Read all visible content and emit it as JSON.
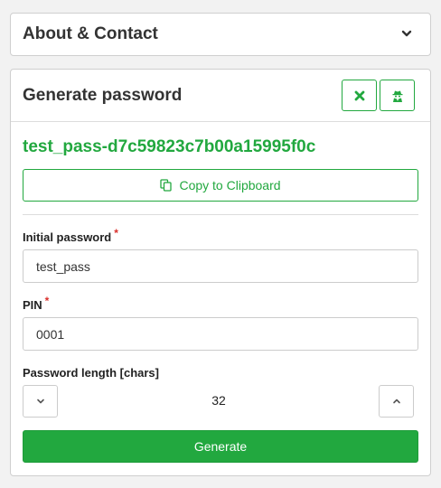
{
  "about": {
    "title": "About & Contact",
    "toggle_icon": "chevron-down-icon"
  },
  "generator": {
    "title": "Generate password",
    "clear_icon": "x-icon",
    "secret_icon": "user-secret-icon",
    "accent_color": "#22a83f",
    "generated_password": "test_pass-d7c59823c7b00a15995f0c",
    "copy_label": "Copy to Clipboard",
    "copy_icon": "copy-icon",
    "initial_password": {
      "label": "Initial password",
      "required_mark": "*",
      "value": "test_pass"
    },
    "pin": {
      "label": "PIN",
      "required_mark": "*",
      "value": "0001"
    },
    "length": {
      "label": "Password length [chars]",
      "value": "32"
    },
    "generate_label": "Generate"
  }
}
